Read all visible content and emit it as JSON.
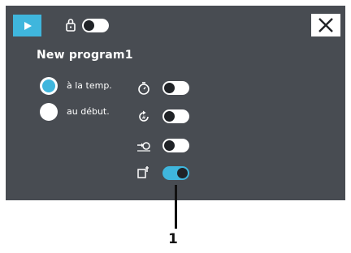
{
  "program": {
    "title": "New program1"
  },
  "start_options": {
    "at_temperature": "à la temp.",
    "at_start": "au début."
  },
  "callout": {
    "number": "1"
  },
  "colors": {
    "panel": "#484c52",
    "accent": "#3fb6dd",
    "foreground": "#ffffff"
  },
  "icons": [
    "play-icon",
    "lock-icon",
    "close-icon",
    "timer-icon",
    "repeat-icon",
    "delay-icon",
    "probe-icon"
  ],
  "states": {
    "lock_toggle": "off",
    "timer_toggle": "off",
    "repeat_toggle": "off",
    "delay_toggle": "off",
    "probe_toggle": "on",
    "selected_start_option": "à la temp."
  }
}
